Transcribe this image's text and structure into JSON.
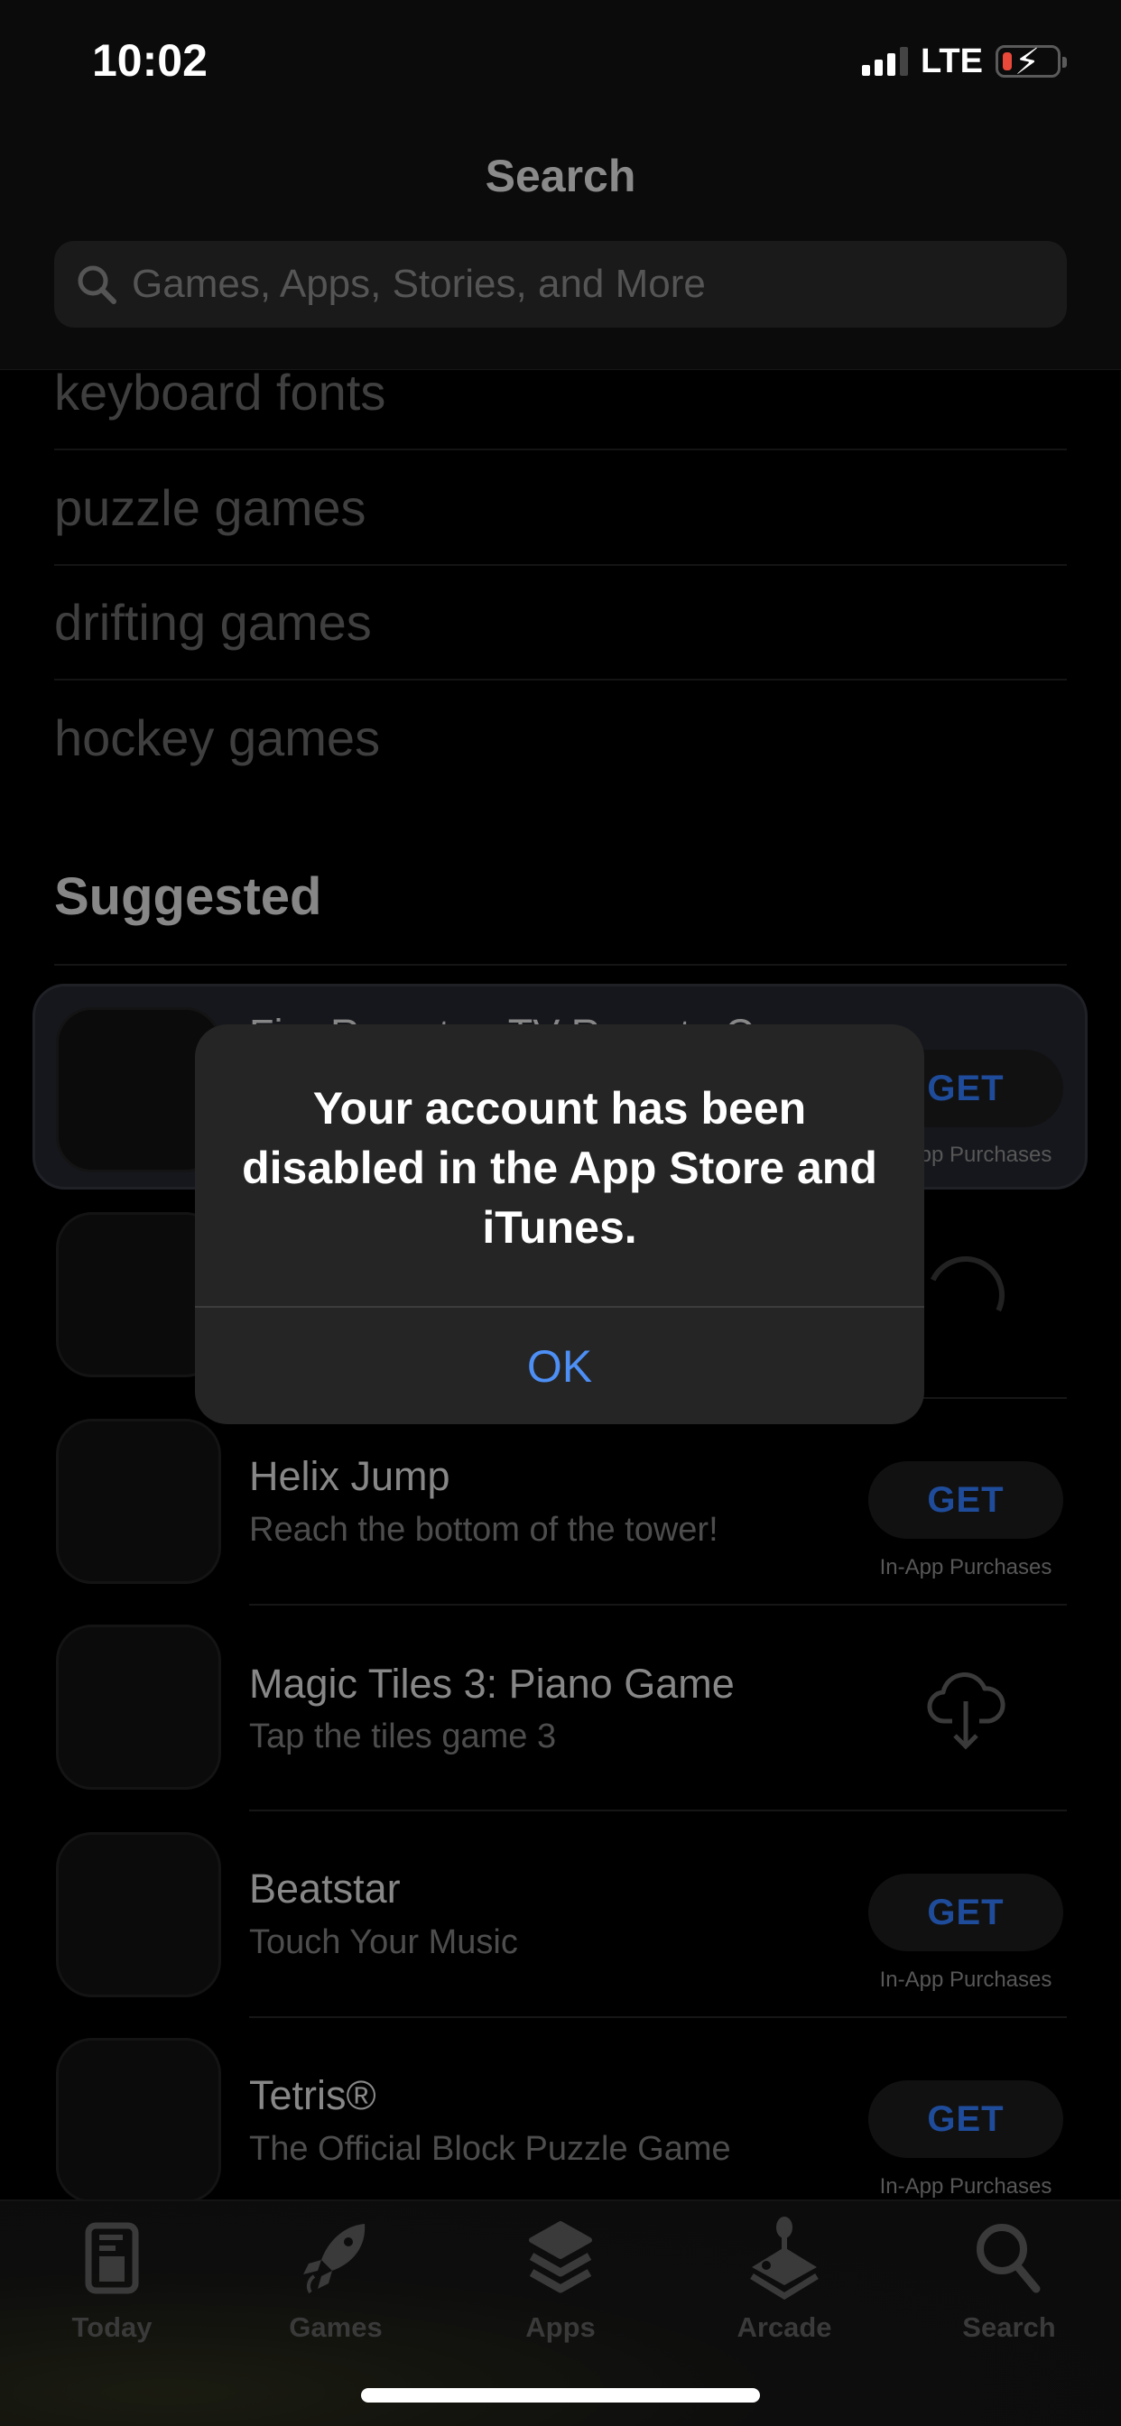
{
  "status_bar": {
    "time": "10:02",
    "network": "LTE",
    "signal_bars": 3,
    "signal_bars_total": 4,
    "battery_charging": true,
    "battery_level_color": "#e9493b"
  },
  "header": {
    "title": "Search",
    "search": {
      "placeholder": "Games, Apps, Stories, and More",
      "value": "",
      "icon": "search-icon"
    }
  },
  "recent_searches": [
    "keyboard fonts",
    "puzzle games",
    "drifting games",
    "hockey games"
  ],
  "suggested": {
    "heading": "Suggested",
    "apps": [
      {
        "name": "Fire Remote - TV Remote C",
        "subtitle": "",
        "action": "GET",
        "note": "In-App Purchases",
        "highlighted": true
      },
      {
        "name": "",
        "subtitle": "",
        "action": "loading",
        "note": ""
      },
      {
        "name": "Helix Jump",
        "subtitle": "Reach the bottom of the tower!",
        "action": "GET",
        "note": "In-App Purchases"
      },
      {
        "name": "Magic Tiles 3: Piano Game",
        "subtitle": "Tap the tiles game 3",
        "action": "redownload",
        "note": ""
      },
      {
        "name": "Beatstar",
        "subtitle": "Touch Your Music",
        "action": "GET",
        "note": "In-App Purchases"
      },
      {
        "name": "Tetris®",
        "subtitle": "The Official Block Puzzle Game",
        "action": "GET",
        "note": "In-App Purchases"
      }
    ]
  },
  "alert": {
    "message": "Your account has been disabled in the App Store and iTunes.",
    "button": "OK",
    "button_color": "#4d8ff5"
  },
  "tab_bar": {
    "tabs": [
      {
        "label": "Today",
        "icon": "today-icon"
      },
      {
        "label": "Games",
        "icon": "rocket-icon"
      },
      {
        "label": "Apps",
        "icon": "layers-icon"
      },
      {
        "label": "Arcade",
        "icon": "joystick-icon"
      },
      {
        "label": "Search",
        "icon": "search-icon"
      }
    ],
    "selected": "Search"
  },
  "colors": {
    "get_text": "#1f4c9a",
    "accent_blue": "#4d8ff5"
  }
}
